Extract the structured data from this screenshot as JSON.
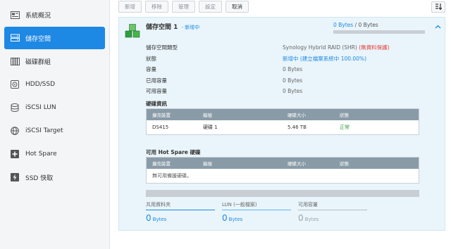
{
  "sidebar": {
    "items": [
      {
        "label": "系統概況",
        "icon": "overview-icon"
      },
      {
        "label": "儲存空間",
        "icon": "storage-pool-icon",
        "active": true
      },
      {
        "label": "磁碟群組",
        "icon": "disk-group-icon"
      },
      {
        "label": "HDD/SSD",
        "icon": "hdd-icon"
      },
      {
        "label": "iSCSI LUN",
        "icon": "iscsi-lun-icon"
      },
      {
        "label": "iSCSI Target",
        "icon": "iscsi-target-icon"
      },
      {
        "label": "Hot Spare",
        "icon": "hot-spare-icon"
      },
      {
        "label": "SSD 快取",
        "icon": "ssd-cache-icon"
      }
    ]
  },
  "toolbar": {
    "create": "新增",
    "remove": "移除",
    "manage": "管理",
    "settings": "設定",
    "cancel": "取消"
  },
  "pool": {
    "title": "儲存空間 1",
    "status": "- 新增中",
    "used": "0 Bytes",
    "separator": "/",
    "total": "0 Bytes"
  },
  "info": [
    {
      "key": "儲存空間類型",
      "value": "Synology Hybrid RAID (SHR)",
      "note": "(無資料保護)"
    },
    {
      "key": "狀態",
      "value": "新增中 (建立檔案系統中 100.00%)"
    },
    {
      "key": "容量",
      "value": "0 Bytes"
    },
    {
      "key": "已用容量",
      "value": "0 Bytes"
    },
    {
      "key": "可用容量",
      "value": "0 Bytes"
    }
  ],
  "disk_info": {
    "title": "硬碟資訊",
    "headers": [
      "擴充裝置",
      "編號",
      "硬碟大小",
      "狀態"
    ],
    "rows": [
      {
        "device": "DS415",
        "number": "硬碟 1",
        "size": "5.46 TB",
        "status": "正常"
      }
    ]
  },
  "hot_spare": {
    "title": "可用 Hot Spare 硬碟",
    "headers": [
      "擴充裝置",
      "編號",
      "硬碟大小",
      "狀態"
    ],
    "empty": "無可用備援硬碟。"
  },
  "stats": [
    {
      "label": "共用資料夾",
      "value": "0",
      "unit": "Bytes"
    },
    {
      "label": "LUN (一般檔案)",
      "value": "0",
      "unit": "Bytes"
    },
    {
      "label": "可用容量",
      "value": "0",
      "unit": "Bytes"
    }
  ],
  "colors": {
    "accent": "#1e88e5",
    "warning": "#e53935",
    "success": "#2e9e3e",
    "header_bg": "#8a9ba8"
  }
}
